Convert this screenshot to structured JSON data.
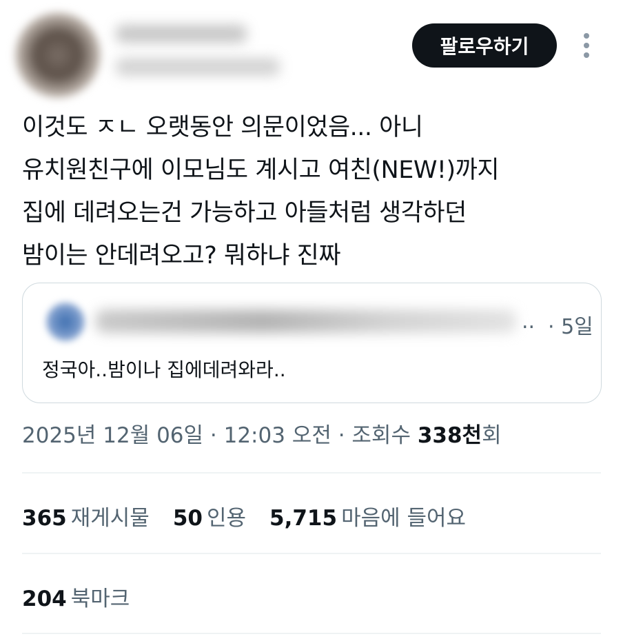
{
  "author": {
    "name": "",
    "handle": ""
  },
  "follow_label": "팔로우하기",
  "more_icon": "more-vertical-icon",
  "tweet": {
    "text": "이것도 ㅈㄴ 오랫동안 의문이었음... 아니\n유치원친구에 이모님도 계시고 여친(NEW!)까지\n집에 데려오는건 가능하고 아들처럼 생각하던\n밤이는 안데려오고? 뭐하냐 진짜"
  },
  "quoted": {
    "ellipsis": "..",
    "time": "· 5일",
    "text": "정국아..밤이나 집에데려와라.."
  },
  "meta": {
    "datetime": "2025년 12월 06일 · 12:03 오전 · 조회수 ",
    "views": "338천",
    "views_suffix": "회"
  },
  "stats": {
    "reposts": {
      "count": "365",
      "label": "재게시물"
    },
    "quotes": {
      "count": "50",
      "label": "인용"
    },
    "likes": {
      "count": "5,715",
      "label": "마음에 들어요"
    },
    "bookmarks": {
      "count": "204",
      "label": "북마크"
    }
  },
  "colors": {
    "primary_text": "#0f1419",
    "secondary_text": "#536471",
    "border": "#cfd9de",
    "divider": "#eff3f4",
    "button_bg": "#0f1419"
  }
}
